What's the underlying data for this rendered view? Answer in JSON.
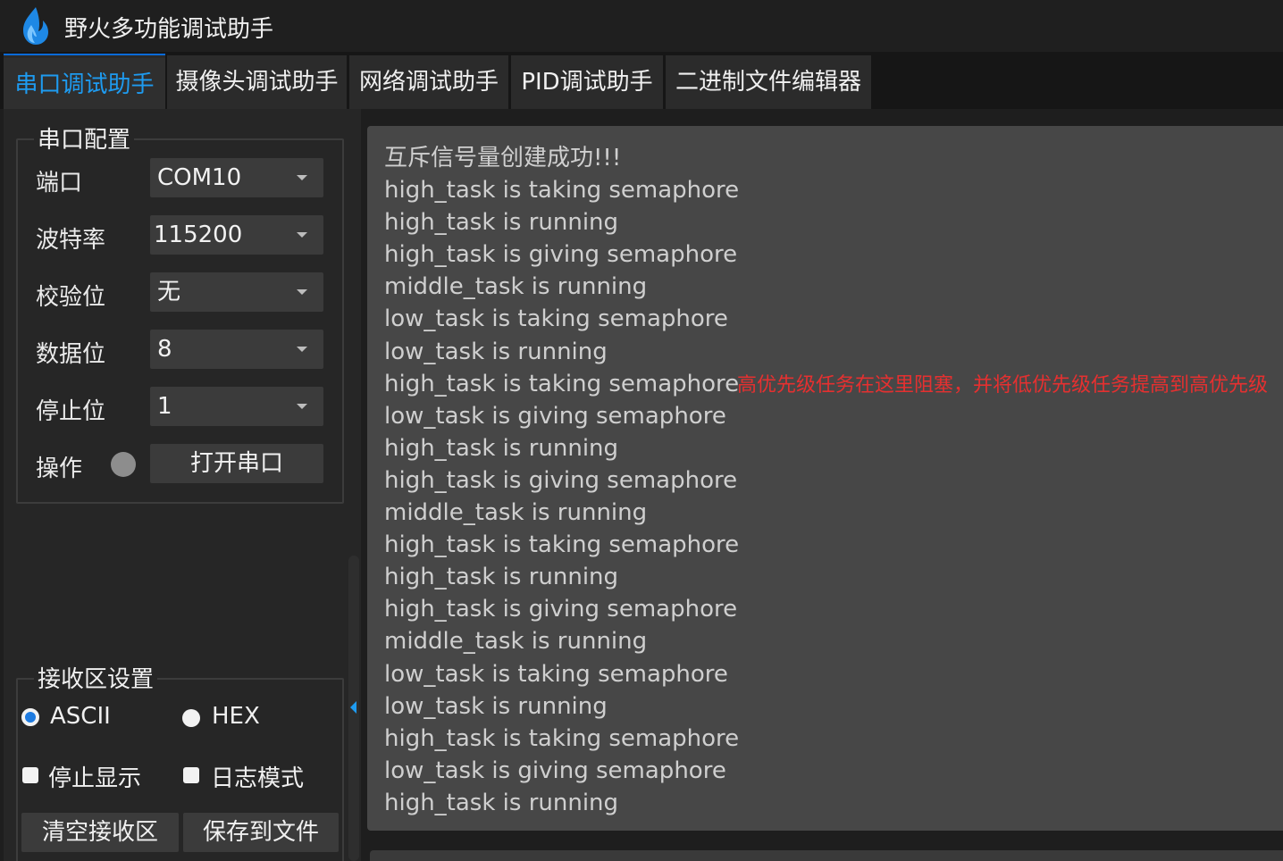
{
  "app": {
    "title": "野火多功能调试助手"
  },
  "tabs": [
    {
      "label": "串口调试助手",
      "active": true
    },
    {
      "label": "摄像头调试助手",
      "active": false
    },
    {
      "label": "网络调试助手",
      "active": false
    },
    {
      "label": "PID调试助手",
      "active": false
    },
    {
      "label": "二进制文件编辑器",
      "active": false
    }
  ],
  "serial_config": {
    "title": "串口配置",
    "port": {
      "label": "端口",
      "value": "COM10"
    },
    "baud": {
      "label": "波特率",
      "value": "115200"
    },
    "parity": {
      "label": "校验位",
      "value": "无"
    },
    "databits": {
      "label": "数据位",
      "value": "8"
    },
    "stopbits": {
      "label": "停止位",
      "value": "1"
    },
    "operation": {
      "label": "操作",
      "open_button": "打开串口",
      "status": "closed"
    }
  },
  "receive_settings": {
    "title": "接收区设置",
    "ascii": {
      "label": "ASCII",
      "checked": true
    },
    "hex": {
      "label": "HEX",
      "checked": false
    },
    "stop_display": {
      "label": "停止显示",
      "checked": false
    },
    "log_mode": {
      "label": "日志模式",
      "checked": false
    },
    "clear_button": "清空接收区",
    "save_button": "保存到文件"
  },
  "receive_area": {
    "lines": [
      "互斥信号量创建成功!!!",
      "high_task is taking semaphore",
      "high_task is running",
      "high_task is giving semaphore",
      "middle_task is running",
      "low_task is taking semaphore",
      "low_task is running",
      "high_task is taking semaphore",
      "low_task is giving semaphore",
      "high_task is running",
      "high_task is giving semaphore",
      "middle_task is running",
      "high_task is taking semaphore",
      "high_task is running",
      "high_task is giving semaphore",
      "middle_task is running",
      "low_task is taking semaphore",
      "low_task is running",
      "high_task is taking semaphore",
      "low_task is giving semaphore",
      "high_task is running"
    ],
    "annotation": "高优先级任务在这里阻塞，并将低优先级任务提高到高优先级"
  },
  "colors": {
    "accent": "#1e9bf0",
    "annotation": "#e53030",
    "background": "#1e1e1e",
    "panel": "#262626",
    "text_area": "#474747"
  }
}
